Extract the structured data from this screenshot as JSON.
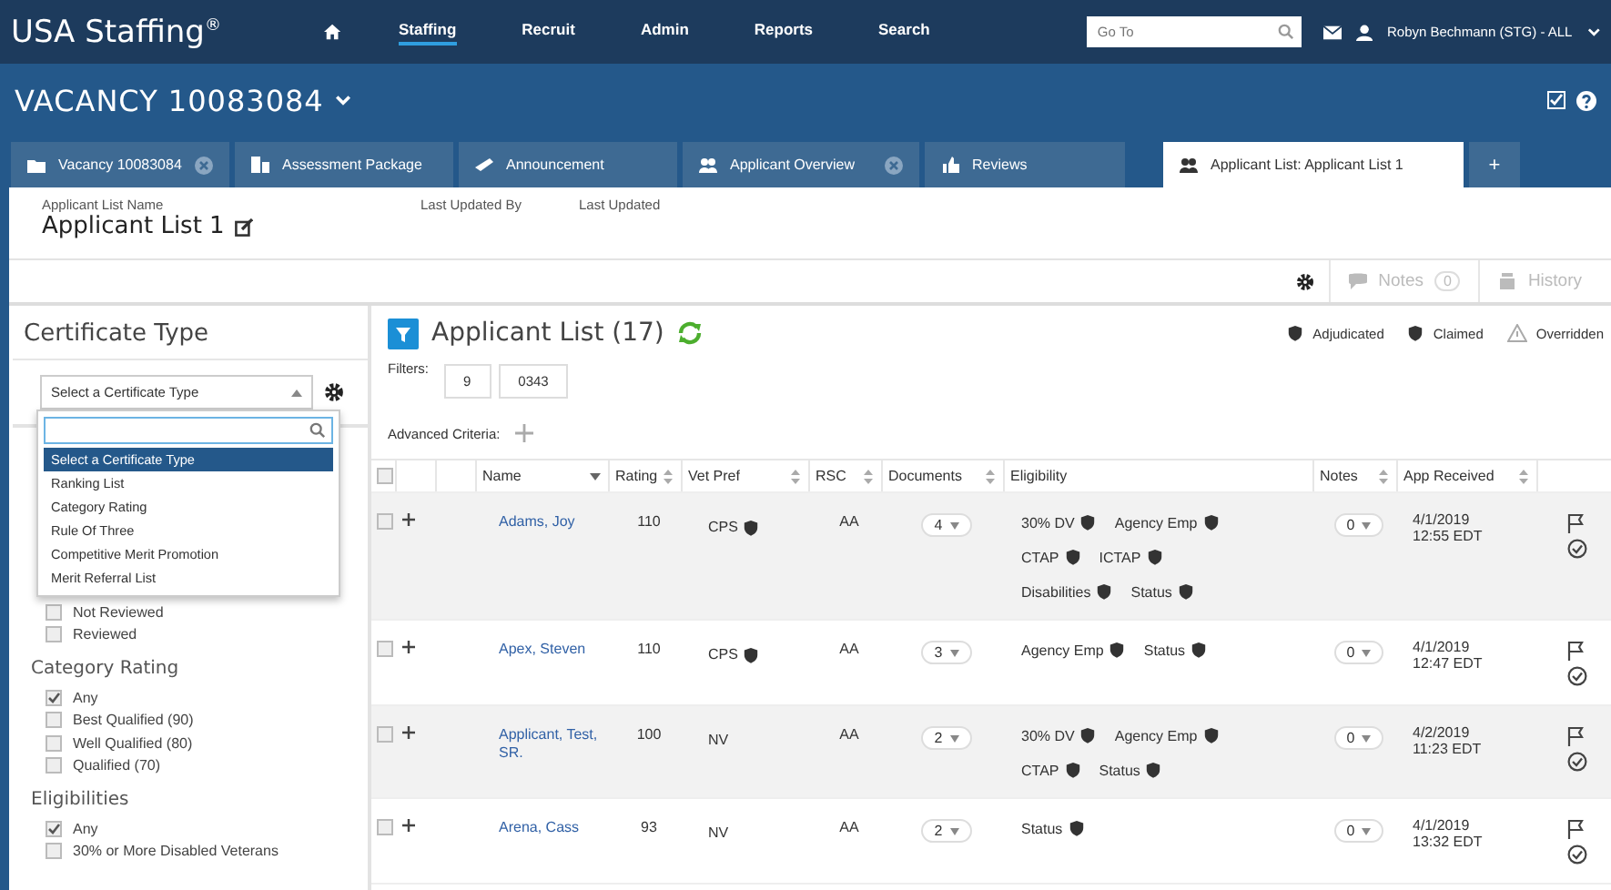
{
  "topbar": {
    "logo": "USA Staffing$^{®}$",
    "nav": [
      {
        "label": "Staffing",
        "selected": true
      },
      {
        "label": "Recruit",
        "selected": false
      },
      {
        "label": "Admin",
        "selected": false
      },
      {
        "label": "Reports",
        "selected": false
      },
      {
        "label": "Search",
        "selected": false
      }
    ],
    "search": {
      "placeholder": "Go To"
    },
    "user": "Robyn Bechmann (STG) - ALL"
  },
  "vacancy": {
    "title": "VACANCY 10083084"
  },
  "tabs": [
    {
      "label": "Vacancy 10083084",
      "selected": false,
      "closable": true
    },
    {
      "label": "Assessment Package",
      "selected": false,
      "closable": false
    },
    {
      "label": "Announcement",
      "selected": false,
      "closable": false
    },
    {
      "label": "Applicant Overview",
      "selected": false,
      "closable": true
    },
    {
      "label": "Reviews",
      "selected": false,
      "closable": false
    },
    {
      "label": "Applicant List: Applicant List 1",
      "selected": true,
      "closable": false
    }
  ],
  "add_tab": "+",
  "list_header": {
    "name_label": "Applicant List Name",
    "name": "Applicant List 1",
    "updated_by_label": "Last Updated By",
    "updated_label": "Last Updated"
  },
  "toolbar": {
    "notes": {
      "label": "Notes",
      "count": "0",
      "disabled": true
    },
    "history": {
      "label": "History",
      "disabled": true
    }
  },
  "sidebar": {
    "title": "Certificate Type",
    "select": {
      "value": "Select a Certificate Type",
      "expanded": true
    },
    "options": [
      {
        "label": "Select a Certificate Type",
        "selected": true
      },
      {
        "label": "Ranking List",
        "selected": false
      },
      {
        "label": "Category Rating",
        "selected": false
      },
      {
        "label": "Rule Of Three",
        "selected": false
      },
      {
        "label": "Competitive Merit Promotion",
        "selected": false
      },
      {
        "label": "Merit Referral List",
        "selected": false
      }
    ],
    "groups": [
      {
        "items": [
          {
            "label": "Not Reviewed",
            "checked": false
          },
          {
            "label": "Reviewed",
            "checked": false
          }
        ]
      },
      {
        "title": "Category Rating",
        "items": [
          {
            "label": "Any",
            "checked": true
          },
          {
            "label": "Best Qualified (90)",
            "checked": false
          },
          {
            "label": "Well Qualified (80)",
            "checked": false
          },
          {
            "label": "Qualified (70)",
            "checked": false
          }
        ]
      },
      {
        "title": "Eligibilities",
        "items": [
          {
            "label": "Any",
            "checked": true
          },
          {
            "label": "30% or More Disabled Veterans",
            "checked": false
          }
        ]
      }
    ]
  },
  "main": {
    "title": "Applicant List (17)",
    "filters_label": "Filters:",
    "filters": [
      "9",
      "0343"
    ],
    "advanced_label": "Advanced Criteria:",
    "legend": [
      {
        "kind": "shield",
        "label": "Adjudicated"
      },
      {
        "kind": "shield",
        "label": "Claimed"
      },
      {
        "kind": "warning",
        "label": "Overridden"
      }
    ]
  },
  "table": {
    "select_all_checked": false,
    "columns": [
      {
        "label": "Name",
        "sortable": true,
        "sorted": true
      },
      {
        "label": "Rating",
        "sortable": true,
        "sorted": false
      },
      {
        "label": "Vet Pref",
        "sortable": true,
        "sorted": false
      },
      {
        "label": "RSC",
        "sortable": true,
        "sorted": false
      },
      {
        "label": "Documents",
        "sortable": true,
        "sorted": false
      },
      {
        "label": "Eligibility",
        "sortable": false
      },
      {
        "label": "Notes",
        "sortable": true,
        "sorted": false
      },
      {
        "label": "App Received",
        "sortable": true,
        "sorted": false
      }
    ],
    "rows": [
      {
        "name": "Adams, Joy",
        "rating": "110",
        "vet_pref": "CPS",
        "vet_badge": true,
        "rsc": "AA",
        "documents": "4",
        "eligibility": [
          "30% DV",
          "Agency Emp",
          "CTAP",
          "ICTAP",
          "Disabilities",
          "Status"
        ],
        "notes": "0",
        "date": "4/1/2019",
        "time": "12:55 EDT",
        "checked": false
      },
      {
        "name": "Apex, Steven",
        "rating": "110",
        "vet_pref": "CPS",
        "vet_badge": true,
        "rsc": "AA",
        "documents": "3",
        "eligibility": [
          "Agency Emp",
          "Status"
        ],
        "notes": "0",
        "date": "4/1/2019",
        "time": "12:47 EDT",
        "checked": false
      },
      {
        "name": "Applicant, Test, SR.",
        "rating": "100",
        "vet_pref": "NV",
        "vet_badge": false,
        "rsc": "AA",
        "documents": "2",
        "eligibility": [
          "30% DV",
          "Agency Emp",
          "CTAP",
          "Status"
        ],
        "notes": "0",
        "date": "4/2/2019",
        "time": "11:23 EDT",
        "checked": false
      },
      {
        "name": "Arena, Cass",
        "rating": "93",
        "vet_pref": "NV",
        "vet_badge": false,
        "rsc": "AA",
        "documents": "2",
        "eligibility": [
          "Status"
        ],
        "notes": "0",
        "date": "4/1/2019",
        "time": "13:32 EDT",
        "checked": false
      }
    ]
  }
}
